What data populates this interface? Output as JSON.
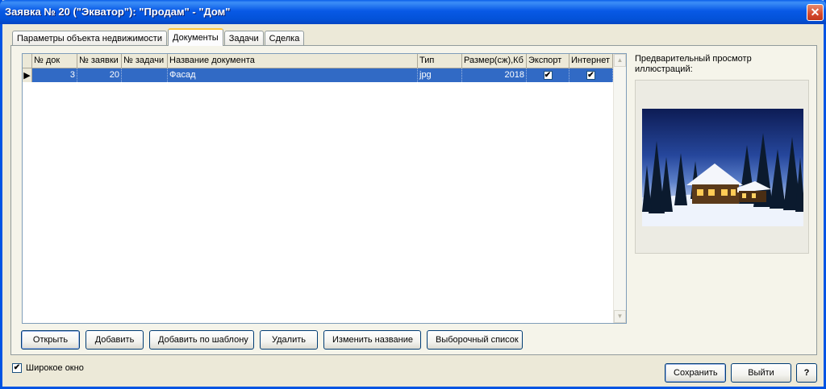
{
  "window": {
    "title": "Заявка № 20 (\"Экватор\"): \"Продам\" - \"Дом\"",
    "close_symbol": "✕"
  },
  "tabs": [
    {
      "label": "Параметры объекта недвижимости",
      "active": false
    },
    {
      "label": "Документы",
      "active": true
    },
    {
      "label": "Задачи",
      "active": false
    },
    {
      "label": "Сделка",
      "active": false
    }
  ],
  "grid": {
    "columns": [
      "№ док",
      "№ заявки",
      "№ задачи",
      "Название документа",
      "Тип",
      "Размер(сж),Кб",
      "Экспорт",
      "Интернет"
    ],
    "rows": [
      {
        "doc_no": "3",
        "request_no": "20",
        "task_no": "",
        "name": "Фасад",
        "type": "jpg",
        "size": "2018",
        "export": true,
        "internet": true,
        "selected": true
      }
    ],
    "row_indicator": "▶",
    "scroll_up_icon": "▲",
    "scroll_down_icon": "▼"
  },
  "buttons": {
    "open": "Открыть",
    "add": "Добавить",
    "add_template": "Добавить по шаблону",
    "delete": "Удалить",
    "rename": "Изменить название",
    "select_list": "Выборочный список"
  },
  "preview": {
    "label": "Предварительный просмотр иллюстраций:"
  },
  "footer": {
    "wide_window_label": "Широкое окно",
    "wide_window_checked": true,
    "check_mark": "✔",
    "save": "Сохранить",
    "exit": "Выйти",
    "help": "?"
  },
  "colors": {
    "title_bar": "#0054e3",
    "selection": "#316ac5",
    "window_bg": "#ece9d8"
  }
}
